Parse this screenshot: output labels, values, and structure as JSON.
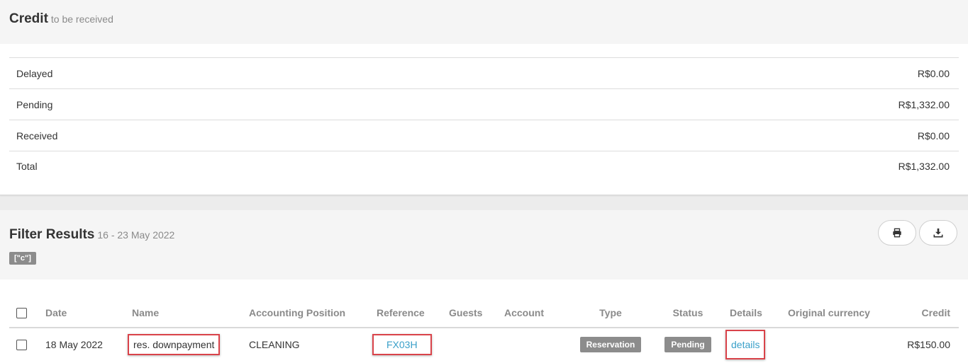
{
  "credit_panel": {
    "title": "Credit",
    "subtitle": "to be received",
    "rows": [
      {
        "label": "Delayed",
        "value": "R$0.00"
      },
      {
        "label": "Pending",
        "value": "R$1,332.00"
      },
      {
        "label": "Received",
        "value": "R$0.00"
      },
      {
        "label": "Total",
        "value": "R$1,332.00"
      }
    ]
  },
  "filter_panel": {
    "title": "Filter Results",
    "date_range": "16 - 23 May 2022",
    "tag": "[\"c\"]",
    "print_icon": "print-icon",
    "download_icon": "download-icon"
  },
  "table": {
    "headers": {
      "date": "Date",
      "name": "Name",
      "accounting_position": "Accounting Position",
      "reference": "Reference",
      "guests": "Guests",
      "account": "Account",
      "type": "Type",
      "status": "Status",
      "details": "Details",
      "original_currency": "Original currency",
      "credit": "Credit"
    },
    "rows": [
      {
        "date": "18 May 2022",
        "name": "res. downpayment",
        "accounting_position": "CLEANING",
        "reference": "FX03H",
        "guests": "",
        "account": "",
        "type": "Reservation",
        "status": "Pending",
        "details": "details",
        "original_currency": "",
        "credit": "R$150.00"
      }
    ]
  },
  "colors": {
    "link": "#3aa0c9",
    "badge": "#8c8c8c",
    "highlight": "#d9434a"
  }
}
